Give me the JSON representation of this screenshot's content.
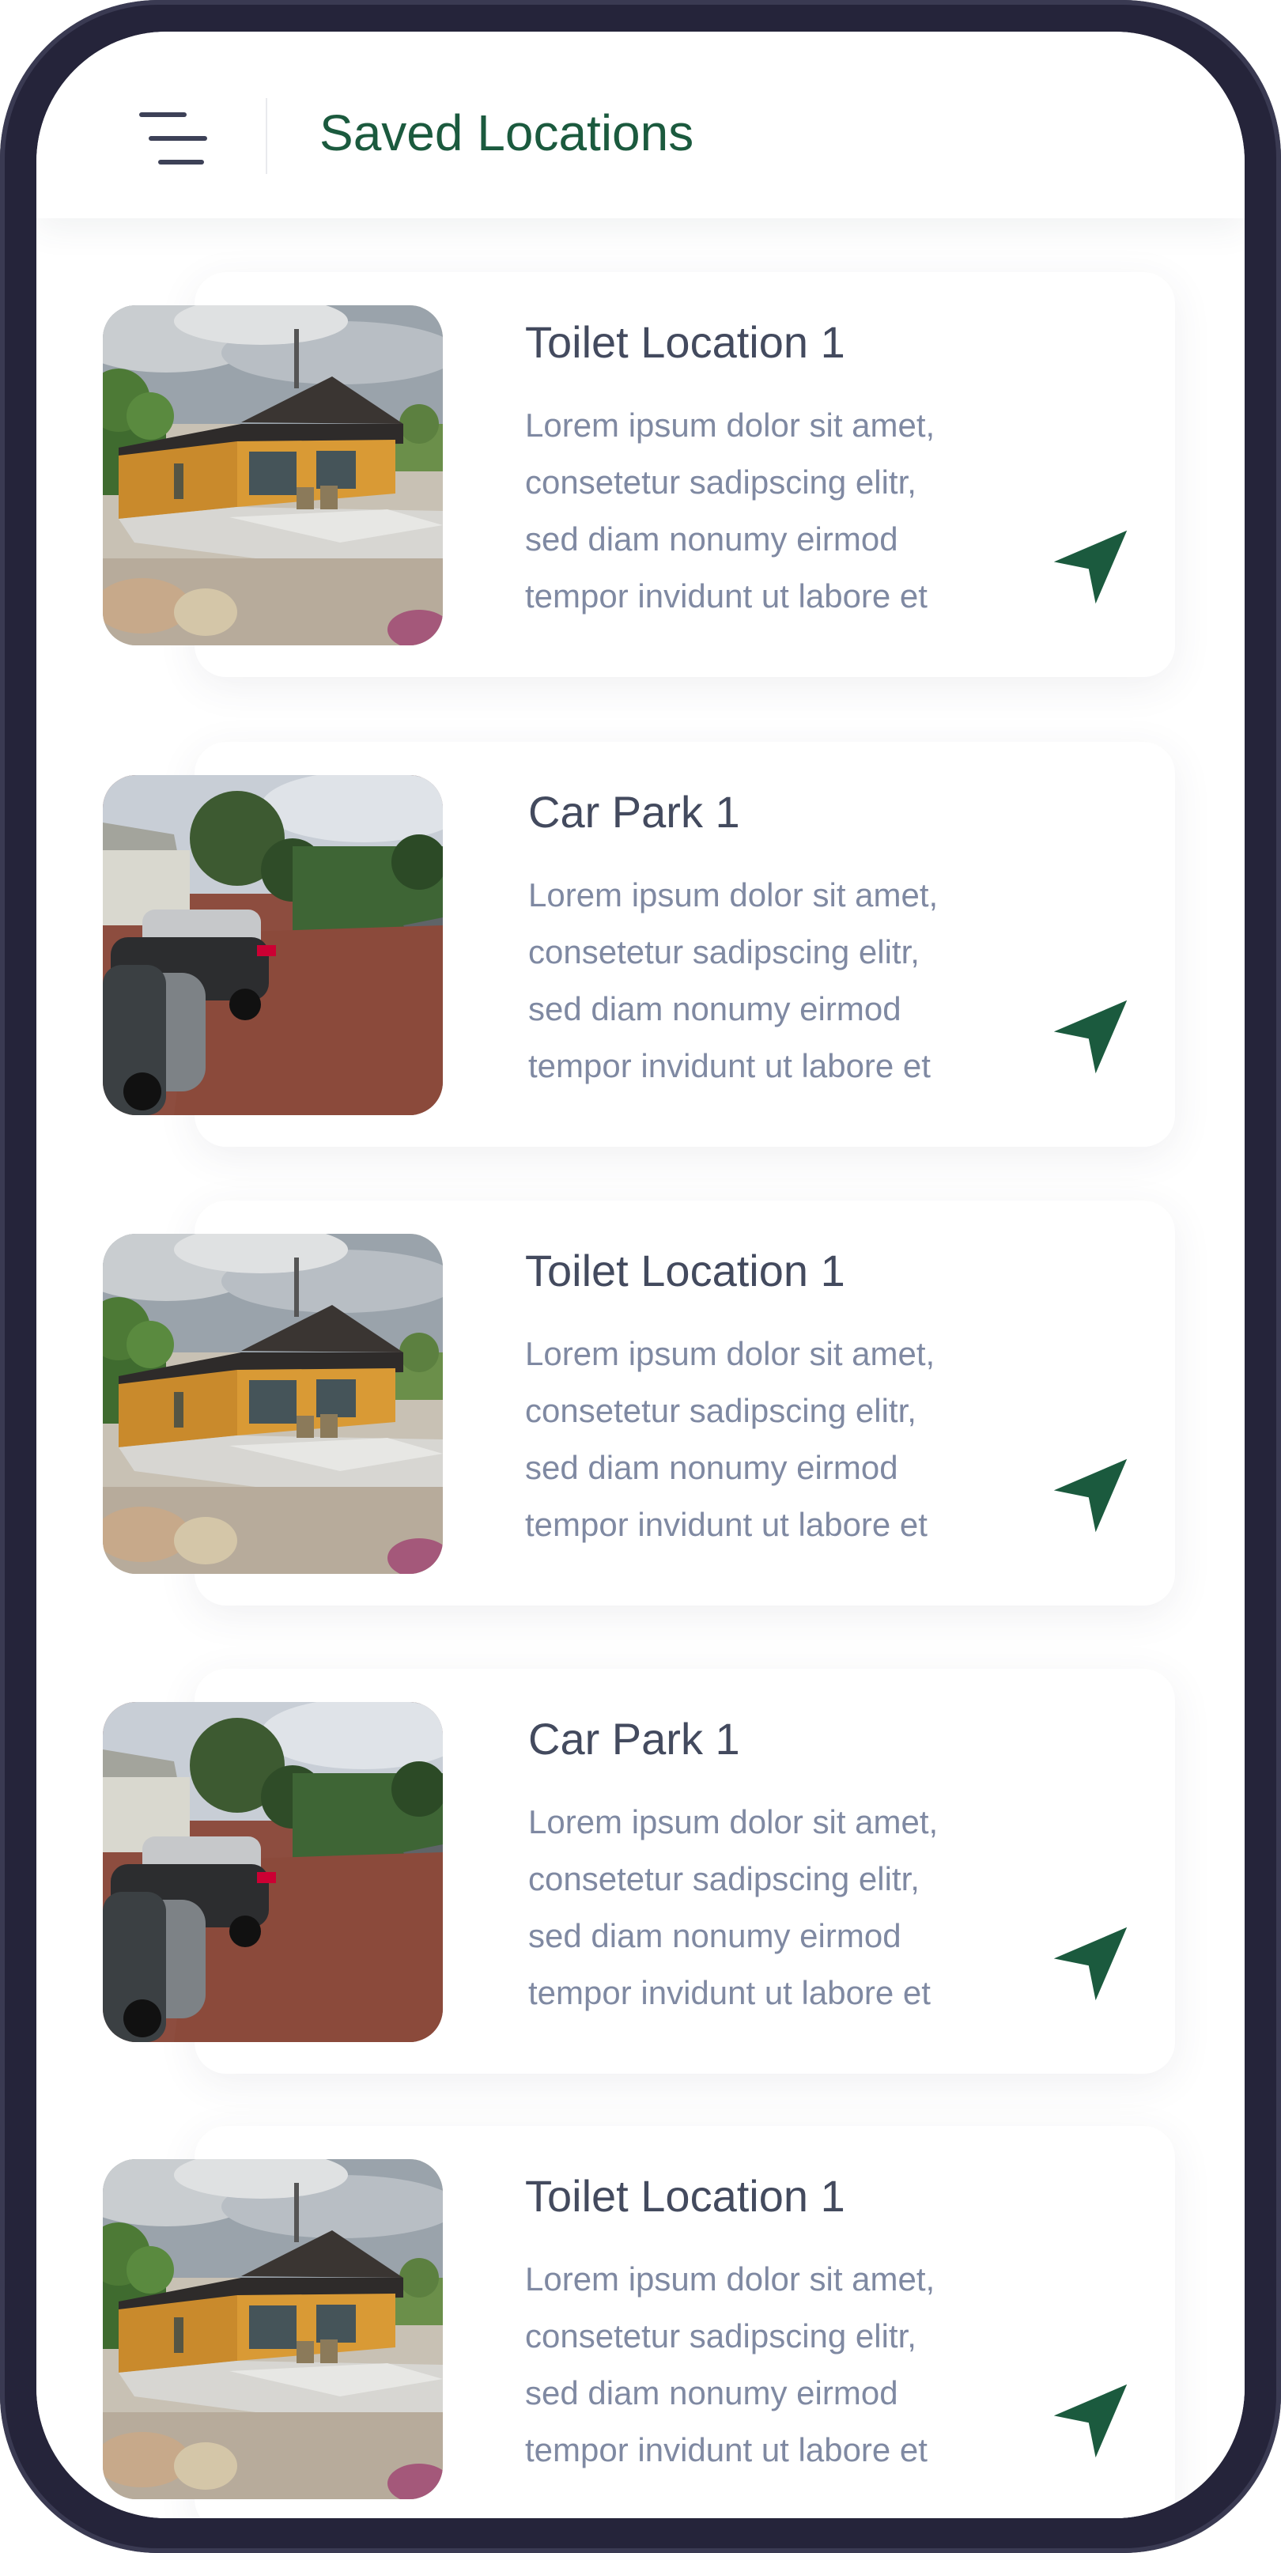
{
  "app": {
    "title": "Saved Locations"
  },
  "icons": {
    "menu": "menu-icon",
    "navigate": "navigation-arrow-icon"
  },
  "colors": {
    "accent": "#1b5a3e",
    "title_text": "#434a5e",
    "body_text": "#7f89a2",
    "frame": "#25243a"
  },
  "locations": [
    {
      "title": "Toilet Location 1",
      "image": "wooden-toilet-cabin-photo",
      "description": [
        "Lorem ipsum dolor sit amet,",
        "consetetur sadipscing elitr,",
        "sed diam nonumy eirmod",
        "tempor invidunt ut labore et"
      ]
    },
    {
      "title": "Car Park 1",
      "image": "car-park-photo",
      "description": [
        "Lorem ipsum dolor sit amet,",
        "consetetur sadipscing elitr,",
        "sed diam nonumy eirmod",
        "tempor invidunt ut labore et"
      ]
    },
    {
      "title": "Toilet Location 1",
      "image": "wooden-toilet-cabin-photo",
      "description": [
        "Lorem ipsum dolor sit amet,",
        "consetetur sadipscing elitr,",
        "sed diam nonumy eirmod",
        "tempor invidunt ut labore et"
      ]
    },
    {
      "title": "Car Park 1",
      "image": "car-park-photo",
      "description": [
        "Lorem ipsum dolor sit amet,",
        "consetetur sadipscing elitr,",
        "sed diam nonumy eirmod",
        "tempor invidunt ut labore et"
      ]
    },
    {
      "title": "Toilet Location 1",
      "image": "wooden-toilet-cabin-photo",
      "description": [
        "Lorem ipsum dolor sit amet,",
        "consetetur sadipscing elitr,",
        "sed diam nonumy eirmod",
        "tempor invidunt ut labore et"
      ]
    }
  ]
}
